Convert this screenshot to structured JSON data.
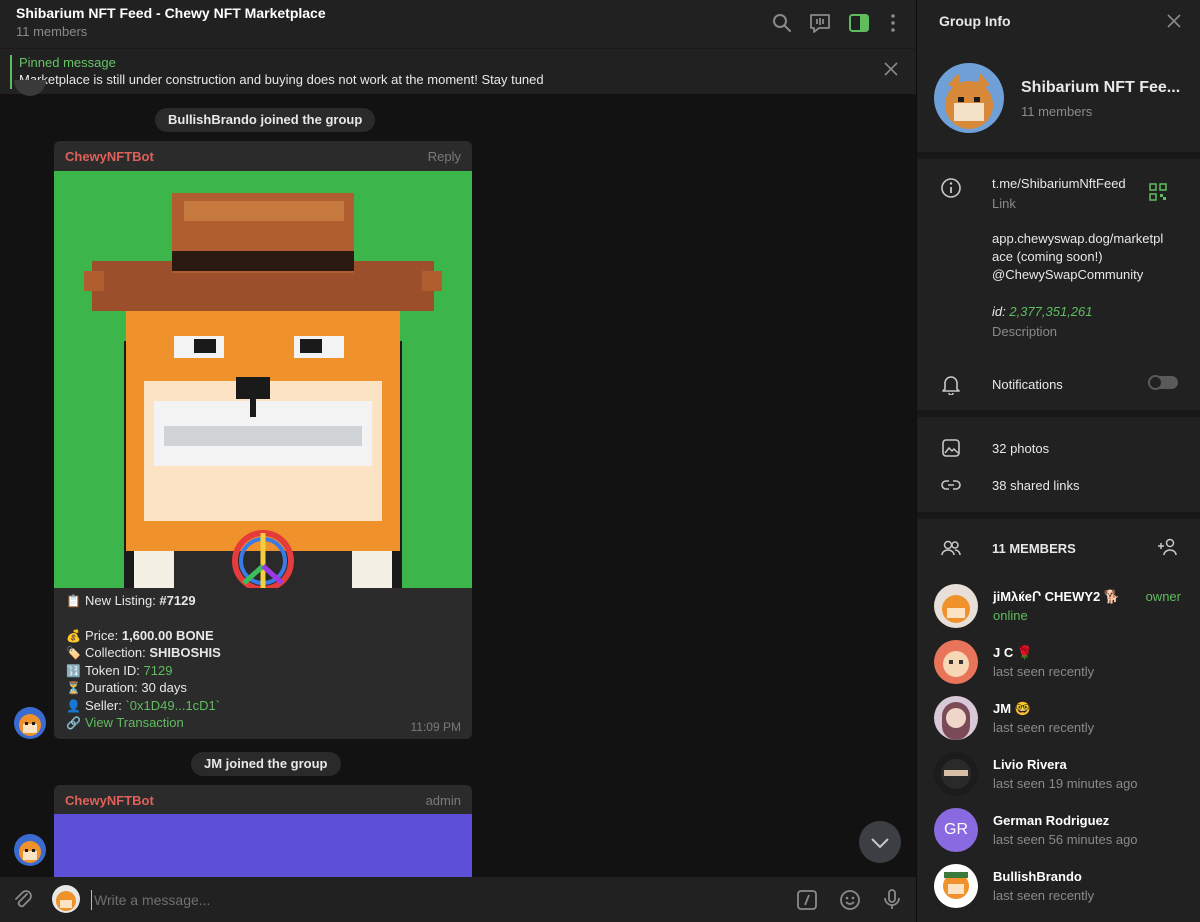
{
  "colors": {
    "accent": "#5fbd5f",
    "sender": "#e0605a",
    "background": "#121212",
    "panel": "#212121"
  },
  "chat": {
    "title": "Shibarium NFT Feed - Chewy NFT Marketplace",
    "subtitle": "11 members",
    "header_icons": [
      "search-icon",
      "group-call-icon",
      "sidebar-toggle-icon",
      "more-vert-icon"
    ],
    "pinned": {
      "label": "Pinned message",
      "text": "Marketplace is still under construction and buying does not work at the moment! Stay tuned"
    },
    "service1": "BullishBrando joined the group",
    "message1": {
      "sender": "ChewyNFTBot",
      "tag": "Reply",
      "listing_label": "New Listing: ",
      "listing_value": "#7129",
      "price_label": "Price: ",
      "price_value": "1,600.00 BONE",
      "collection_label": "Collection: ",
      "collection_value": "SHIBOSHIS",
      "token_label": "Token ID: ",
      "token_value": "7129",
      "duration": "Duration: 30 days",
      "seller_label": "Seller: ",
      "seller_value": "`0x1D49...1cD1`",
      "link": "View Transaction",
      "time": "11:09 PM"
    },
    "service2": "JM joined the group",
    "message2": {
      "sender": "ChewyNFTBot",
      "tag": "admin"
    },
    "composer_placeholder": "Write a message..."
  },
  "panel": {
    "title": "Group Info",
    "group_name": "Shibarium NFT Fee...",
    "group_members": "11 members",
    "link": "t.me/ShibariumNftFeed",
    "link_label": "Link",
    "desc_line1": "app.chewyswap.dog/marketpl",
    "desc_line2": "ace (coming soon!)",
    "desc_handle": "@ChewySwapCommunity",
    "id_label": "id: ",
    "id_value": "2,377,351,261",
    "desc_label": "Description",
    "notifications": "Notifications",
    "photos": "32 photos",
    "links": "38 shared links",
    "members_header": "11 MEMBERS",
    "members": [
      {
        "name": "jiMλќeՐ CHEWY2 🐕",
        "status": "online",
        "role": "owner"
      },
      {
        "name": "J C 🌹",
        "status": "last seen recently",
        "role": ""
      },
      {
        "name": "JM 🤓",
        "status": "last seen recently",
        "role": ""
      },
      {
        "name": "Livio Rivera",
        "status": "last seen 19 minutes ago",
        "role": ""
      },
      {
        "name": "German Rodriguez",
        "status": "last seen 56 minutes ago",
        "role": "",
        "initials": "GR"
      },
      {
        "name": "BullishBrando",
        "status": "last seen recently",
        "role": ""
      }
    ]
  }
}
